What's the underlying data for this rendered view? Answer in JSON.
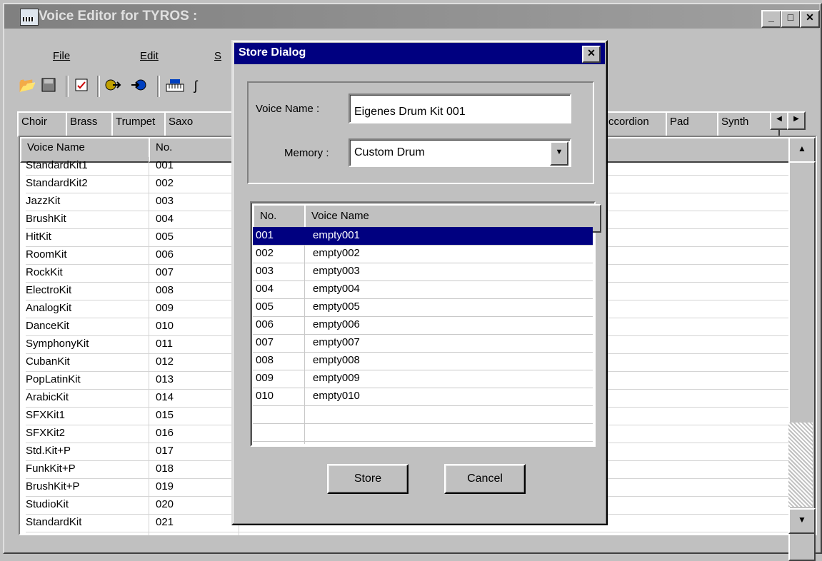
{
  "window": {
    "title": "Voice Editor for TYROS :",
    "min": "_",
    "max": "□",
    "close": "✕"
  },
  "menu": {
    "file": "File",
    "edit": "Edit",
    "third": "S"
  },
  "toolbar": [
    "open-icon",
    "save-icon",
    "properties-icon",
    "send-icon",
    "receive-icon",
    "keyboard-icon",
    "ear-icon"
  ],
  "tabs": {
    "visible_left": [
      "Choir",
      "Brass",
      "Trumpet",
      "Saxo"
    ],
    "visible_right": [
      "ccordion",
      "Pad",
      "Synth"
    ]
  },
  "list": {
    "headers": {
      "name": "Voice Name",
      "no": "No."
    },
    "rows": [
      {
        "name": "StandardKit1",
        "no": "001"
      },
      {
        "name": "StandardKit2",
        "no": "002"
      },
      {
        "name": "JazzKit",
        "no": "003"
      },
      {
        "name": "BrushKit",
        "no": "004"
      },
      {
        "name": "HitKit",
        "no": "005"
      },
      {
        "name": "RoomKit",
        "no": "006"
      },
      {
        "name": "RockKit",
        "no": "007"
      },
      {
        "name": "ElectroKit",
        "no": "008"
      },
      {
        "name": "AnalogKit",
        "no": "009"
      },
      {
        "name": "DanceKit",
        "no": "010"
      },
      {
        "name": "SymphonyKit",
        "no": "011"
      },
      {
        "name": "CubanKit",
        "no": "012"
      },
      {
        "name": "PopLatinKit",
        "no": "013"
      },
      {
        "name": "ArabicKit",
        "no": "014"
      },
      {
        "name": "SFXKit1",
        "no": "015"
      },
      {
        "name": "SFXKit2",
        "no": "016"
      },
      {
        "name": "Std.Kit+P",
        "no": "017"
      },
      {
        "name": "FunkKit+P",
        "no": "018"
      },
      {
        "name": "BrushKit+P",
        "no": "019"
      },
      {
        "name": "StudioKit",
        "no": "020"
      },
      {
        "name": "StandardKit",
        "no": "021"
      }
    ]
  },
  "dialog": {
    "title": "Store Dialog",
    "voice_name_label": "Voice Name :",
    "voice_name_value": "Eigenes Drum Kit 001",
    "memory_label": "Memory :",
    "memory_value": "Custom Drum",
    "list_headers": {
      "no": "No.",
      "name": "Voice Name"
    },
    "slots": [
      {
        "no": "001",
        "name": "empty001",
        "selected": true
      },
      {
        "no": "002",
        "name": "empty002"
      },
      {
        "no": "003",
        "name": "empty003"
      },
      {
        "no": "004",
        "name": "empty004"
      },
      {
        "no": "005",
        "name": "empty005"
      },
      {
        "no": "006",
        "name": "empty006"
      },
      {
        "no": "007",
        "name": "empty007"
      },
      {
        "no": "008",
        "name": "empty008"
      },
      {
        "no": "009",
        "name": "empty009"
      },
      {
        "no": "010",
        "name": "empty010"
      }
    ],
    "store_label": "Store",
    "cancel_label": "Cancel"
  },
  "colors": {
    "selection": "#000080",
    "title_active": "#000080",
    "title_inactive": "#808080"
  }
}
